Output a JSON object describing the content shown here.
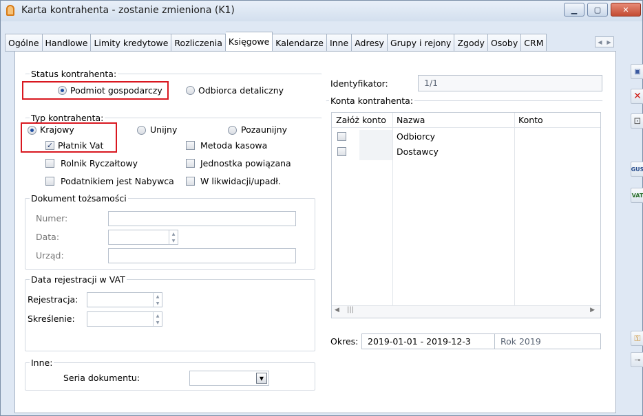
{
  "window": {
    "title": "Karta kontrahenta - zostanie zmieniona (K1)",
    "controls": {
      "minimize": "▁",
      "maximize": "▢",
      "close": "✕"
    }
  },
  "tabs": [
    "Ogólne",
    "Handlowe",
    "Limity kredytowe",
    "Rozliczenia",
    "Księgowe",
    "Kalendarze",
    "Inne",
    "Adresy",
    "Grupy i rejony",
    "Zgody",
    "Osoby",
    "CRM"
  ],
  "active_tab": "Księgowe",
  "status": {
    "label": "Status kontrahenta:",
    "options": [
      "Podmiot gospodarczy",
      "Odbiorca detaliczny"
    ],
    "selected": "Podmiot gospodarczy"
  },
  "typ": {
    "label": "Typ kontrahenta:",
    "options": [
      "Krajowy",
      "Unijny",
      "Pozaunijny"
    ],
    "selected": "Krajowy",
    "checkboxes": [
      {
        "label": "Płatnik Vat",
        "checked": true
      },
      {
        "label": "Metoda kasowa",
        "checked": false
      },
      {
        "label": "Rolnik Ryczałtowy",
        "checked": false
      },
      {
        "label": "Jednostka powiązana",
        "checked": false
      },
      {
        "label": "Podatnikiem jest Nabywca",
        "checked": false
      },
      {
        "label": "W likwidacji/upadł.",
        "checked": false
      }
    ]
  },
  "dokument": {
    "title": "Dokument tożsamości",
    "numer_label": "Numer:",
    "data_label": "Data:",
    "urzad_label": "Urząd:",
    "numer_value": "",
    "data_value": "",
    "urzad_value": ""
  },
  "vat": {
    "title": "Data rejestracji w VAT",
    "rejestracja_label": "Rejestracja:",
    "skreslenie_label": "Skreślenie:",
    "rejestracja_value": "",
    "skreslenie_value": ""
  },
  "inne": {
    "title": "Inne:",
    "seria_label": "Seria dokumentu:",
    "seria_value": ""
  },
  "identyfikator": {
    "label": "Identyfikator:",
    "value": "1/1"
  },
  "konta": {
    "title": "Konta kontrahenta:",
    "columns": [
      "Załóż konto",
      "Nazwa",
      "Konto"
    ],
    "rows": [
      {
        "nazwa": "Odbiorcy",
        "konto": "",
        "checked": false
      },
      {
        "nazwa": "Dostawcy",
        "konto": "",
        "checked": false
      }
    ],
    "scroll_thumb": "|||"
  },
  "okres": {
    "label": "Okres:",
    "value": "2019-01-01 - 2019-12-3",
    "rok": "Rok 2019"
  },
  "sidebar": {
    "buttons": [
      "save-icon",
      "delete-icon",
      "book-icon",
      "gus-icon",
      "vat-icon",
      "lock-icon",
      "pin-icon"
    ],
    "gus_text": "GUS",
    "vat_text": "VAT"
  }
}
